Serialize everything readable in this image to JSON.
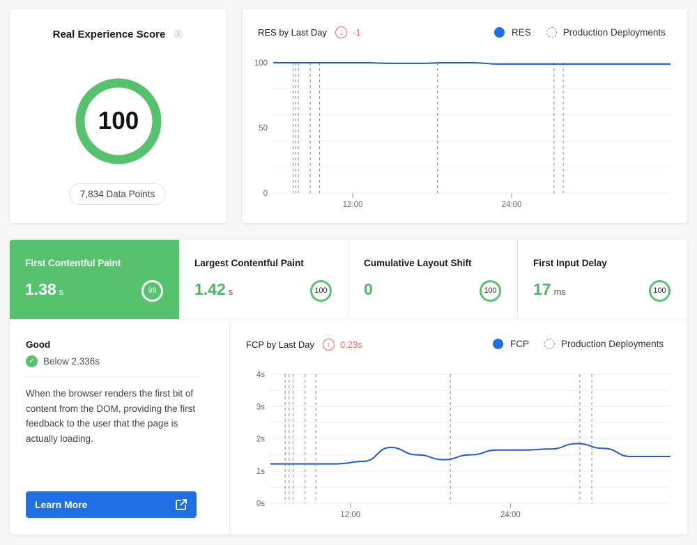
{
  "score_card": {
    "title": "Real Experience Score",
    "info_icon": "i",
    "score": "100",
    "score_fraction": 1.0,
    "data_points": "7,834 Data Points",
    "ring_color": "#56c26e"
  },
  "res_chart": {
    "title": "RES by Last Day",
    "delta_icon": "↓",
    "delta": "-1",
    "legend": {
      "series": "RES",
      "deployments": "Production Deployments"
    }
  },
  "metrics": [
    {
      "label": "First Contentful Paint",
      "value": "1.38",
      "unit": "s",
      "score": "99",
      "active": true
    },
    {
      "label": "Largest Contentful Paint",
      "value": "1.42",
      "unit": "s",
      "score": "100",
      "active": false
    },
    {
      "label": "Cumulative Layout Shift",
      "value": "0",
      "unit": "",
      "score": "100",
      "active": false
    },
    {
      "label": "First Input Delay",
      "value": "17",
      "unit": "ms",
      "score": "100",
      "active": false
    }
  ],
  "detail": {
    "status": "Good",
    "check_icon": "✓",
    "threshold": "Below 2.336s",
    "description": "When the browser renders the first bit of content from the DOM, providing the first feedback to the user that the page is actually loading.",
    "learn_more": "Learn More"
  },
  "fcp_chart": {
    "title": "FCP by Last Day",
    "delta_icon": "↑",
    "delta": "0.23s",
    "legend": {
      "series": "FCP",
      "deployments": "Production Deployments"
    }
  },
  "colors": {
    "accent_blue": "#1f6fe5",
    "good_green": "#56c26e",
    "delta_red": "#e06c5a",
    "line_blue": "#1d5bc4"
  },
  "chart_data": [
    {
      "type": "line",
      "title": "RES by Last Day",
      "xlabel": "",
      "ylabel": "",
      "x_range_hours": [
        6,
        36
      ],
      "x_ticks": [
        {
          "hour": 12,
          "label": "12:00"
        },
        {
          "hour": 24,
          "label": "24:00"
        }
      ],
      "ylim": [
        0,
        100
      ],
      "y_ticks": [
        {
          "v": 0,
          "label": "0"
        },
        {
          "v": 50,
          "label": "50"
        },
        {
          "v": 100,
          "label": "100"
        }
      ],
      "y_grid": [
        0,
        20,
        40,
        60,
        80,
        100
      ],
      "grid": true,
      "legend": "top-right",
      "series": [
        {
          "name": "RES",
          "x": [
            6,
            10,
            13,
            15,
            17,
            19,
            21,
            23,
            25,
            27,
            29,
            31,
            33,
            36
          ],
          "values": [
            100,
            100,
            100,
            99.5,
            99.5,
            100,
            100,
            99,
            99,
            99,
            99,
            99,
            99,
            99
          ]
        }
      ],
      "deployments_hours": [
        7.5,
        7.7,
        7.9,
        8.8,
        9.5,
        18.4,
        27.2,
        27.9
      ]
    },
    {
      "type": "line",
      "title": "FCP by Last Day",
      "xlabel": "",
      "ylabel": "",
      "x_range_hours": [
        6,
        36
      ],
      "x_ticks": [
        {
          "hour": 12,
          "label": "12:00"
        },
        {
          "hour": 24,
          "label": "24:00"
        }
      ],
      "ylim": [
        0,
        4
      ],
      "y_ticks": [
        {
          "v": 0,
          "label": "0s"
        },
        {
          "v": 1,
          "label": "1s"
        },
        {
          "v": 2,
          "label": "2s"
        },
        {
          "v": 3,
          "label": "3s"
        },
        {
          "v": 4,
          "label": "4s"
        }
      ],
      "y_grid": [
        0,
        0.5,
        1,
        1.5,
        2,
        2.5,
        3,
        3.5,
        4
      ],
      "grid": true,
      "legend": "top-right",
      "series": [
        {
          "name": "FCP",
          "x": [
            6,
            9,
            11,
            13,
            15,
            17,
            19,
            21,
            23,
            25,
            27,
            29,
            31,
            33,
            36
          ],
          "values": [
            1.22,
            1.22,
            1.22,
            1.3,
            1.73,
            1.5,
            1.35,
            1.5,
            1.65,
            1.65,
            1.68,
            1.85,
            1.7,
            1.45,
            1.45
          ]
        }
      ],
      "deployments_hours": [
        7.1,
        7.4,
        7.7,
        8.6,
        9.4,
        19.5,
        29.2,
        30.1
      ]
    }
  ]
}
